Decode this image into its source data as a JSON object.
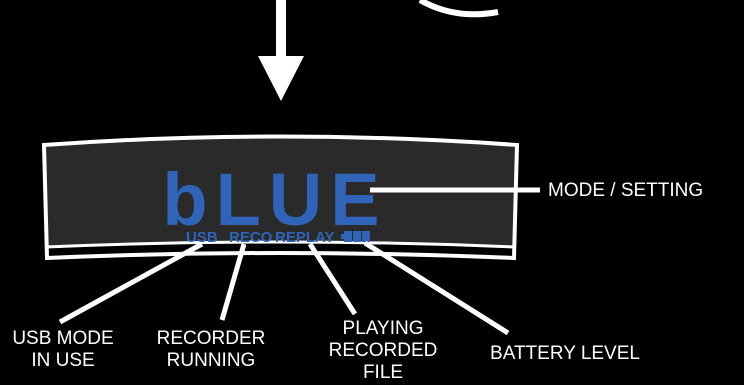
{
  "lcd": {
    "main_text": "bLUE",
    "indicators": {
      "usb": "USB",
      "reco": "RECO",
      "replay": "REPLAY"
    },
    "battery_icon": "battery-icon",
    "segment_color": "#2f64b8",
    "panel_color": "#2a2a2a",
    "bezel_color": "#ffffff"
  },
  "callouts": {
    "mode_setting": "MODE / SETTING",
    "usb_mode_line1": "USB MODE",
    "usb_mode_line2": "IN USE",
    "recorder_line1": "RECORDER",
    "recorder_line2": "RUNNING",
    "playing_line1": "PLAYING",
    "playing_line2": "RECORDED",
    "playing_line3": "FILE",
    "battery_level": "BATTERY LEVEL"
  },
  "arrow_icon": "down-arrow-icon",
  "background_color": "#000000"
}
